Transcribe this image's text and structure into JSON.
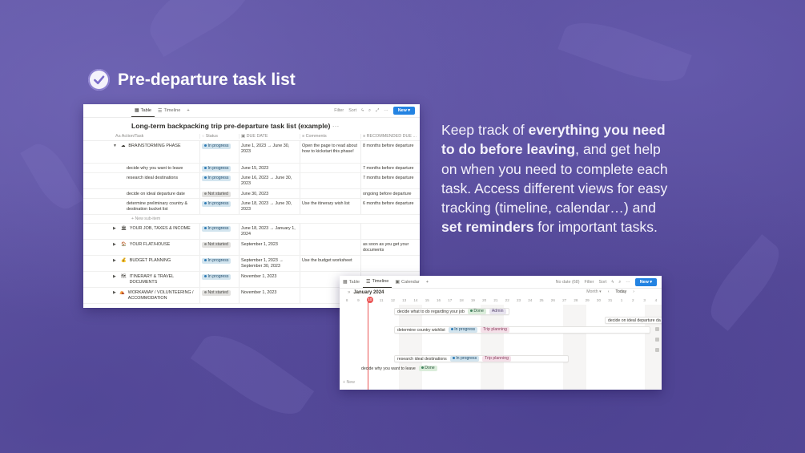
{
  "header": {
    "title": "Pre-departure task list",
    "icon": "checkmark-icon"
  },
  "description": {
    "p1": "Keep track of ",
    "b1": "everything you need to do before leaving",
    "p2": ", and get help on when you need to complete each task. Access different views for easy tracking (timeline, calendar…) and ",
    "b2": "set reminders",
    "p3": " for important tasks."
  },
  "table_view": {
    "tabs": [
      {
        "label": "Table",
        "icon": "table-icon"
      },
      {
        "label": "Timeline",
        "icon": "timeline-icon"
      }
    ],
    "toolbar": {
      "filter": "Filter",
      "sort": "Sort",
      "new_label": "New"
    },
    "db_title": "Long-term backpacking trip pre-departure task list (example)",
    "columns": [
      "Action/Task",
      "Status",
      "DUE DATE",
      "Comments",
      "RECOMMENDED DUE ..."
    ],
    "rows": [
      {
        "task": "BRAINSTORMING PHASE",
        "emoji": "☁",
        "status": "In progress",
        "due": "June 1, 2023 → June 30, 2023",
        "comments": "Open the page to read about how to kickstart this phase!",
        "rec": "8 months before departure"
      },
      {
        "task": "decide why you want to leave",
        "status": "In progress",
        "due": "June 15, 2023",
        "comments": "",
        "rec": "7 months before departure"
      },
      {
        "task": "research ideal destinations",
        "status": "In progress",
        "due": "June 16, 2023 → June 30, 2023",
        "comments": "",
        "rec": "7 months before departure"
      },
      {
        "task": "decide on ideal departure date",
        "status": "Not started",
        "due": "June 30, 2023",
        "comments": "",
        "rec": "ongoing before departure"
      },
      {
        "task": "determine preliminary country & destination bucket list",
        "status": "In progress",
        "due": "June 18, 2023 → June 30, 2023",
        "comments": "Use the itinerary wish list",
        "rec": "6 months before departure"
      },
      {
        "task": "YOUR JOB, TAXES & INCOME",
        "emoji": "🏛",
        "status": "In progress",
        "due": "June 18, 2023 → January 1, 2024",
        "comments": "",
        "rec": ""
      },
      {
        "task": "YOUR FLAT/HOUSE",
        "emoji": "🏠",
        "status": "Not started",
        "due": "September 1, 2023",
        "comments": "",
        "rec": "as soon as you get your documents"
      },
      {
        "task": "BUDGET PLANNING",
        "emoji": "💰",
        "status": "In progress",
        "due": "September 1, 2023 → September 30, 2023",
        "comments": "Use the budget worksheet",
        "rec": ""
      },
      {
        "task": "ITINERARY & TRAVEL DOCUMENTS",
        "emoji": "🗺",
        "status": "In progress",
        "due": "November 1, 2023",
        "comments": "",
        "rec": ""
      },
      {
        "task": "WORKAWAY / VOLUNTEERING / ACCOMMODATION",
        "emoji": "⛺",
        "status": "Not started",
        "due": "November 1, 2023",
        "comments": "",
        "rec": ""
      }
    ],
    "new_sub": "+ New sub-item"
  },
  "timeline_view": {
    "tabs": [
      {
        "label": "Table",
        "icon": "table-icon"
      },
      {
        "label": "Timeline",
        "icon": "timeline-icon"
      },
      {
        "label": "Calendar",
        "icon": "calendar-icon"
      }
    ],
    "toolbar": {
      "no_date": "No date (68)",
      "filter": "Filter",
      "sort": "Sort",
      "new_label": "New"
    },
    "month": "January 2024",
    "scale": "Month",
    "today": "Today",
    "days": [
      "8",
      "9",
      "10",
      "11",
      "12",
      "13",
      "14",
      "15",
      "16",
      "17",
      "18",
      "19",
      "20",
      "21",
      "22",
      "23",
      "24",
      "25",
      "26",
      "27",
      "28",
      "29",
      "30",
      "31",
      "1",
      "2",
      "3",
      "4"
    ],
    "today_day": "10",
    "bars": [
      {
        "label": "decide what to do regarding your job",
        "tags": [
          {
            "text": "Done",
            "kind": "done"
          },
          {
            "text": "Admin",
            "kind": "admin"
          }
        ]
      },
      {
        "label": "decide on ideal departure da",
        "tags": []
      },
      {
        "label": "determine country wishlist",
        "tags": [
          {
            "text": "In progress",
            "kind": "prog"
          },
          {
            "text": "Trip planning",
            "kind": "trip"
          }
        ]
      },
      {
        "label": "research ideal destinations",
        "tags": [
          {
            "text": "In progress",
            "kind": "prog"
          },
          {
            "text": "Trip planning",
            "kind": "trip"
          }
        ]
      },
      {
        "label": "decide why you want to leave",
        "tags": [
          {
            "text": "Done",
            "kind": "done"
          }
        ]
      }
    ],
    "new_label": "+ New"
  }
}
